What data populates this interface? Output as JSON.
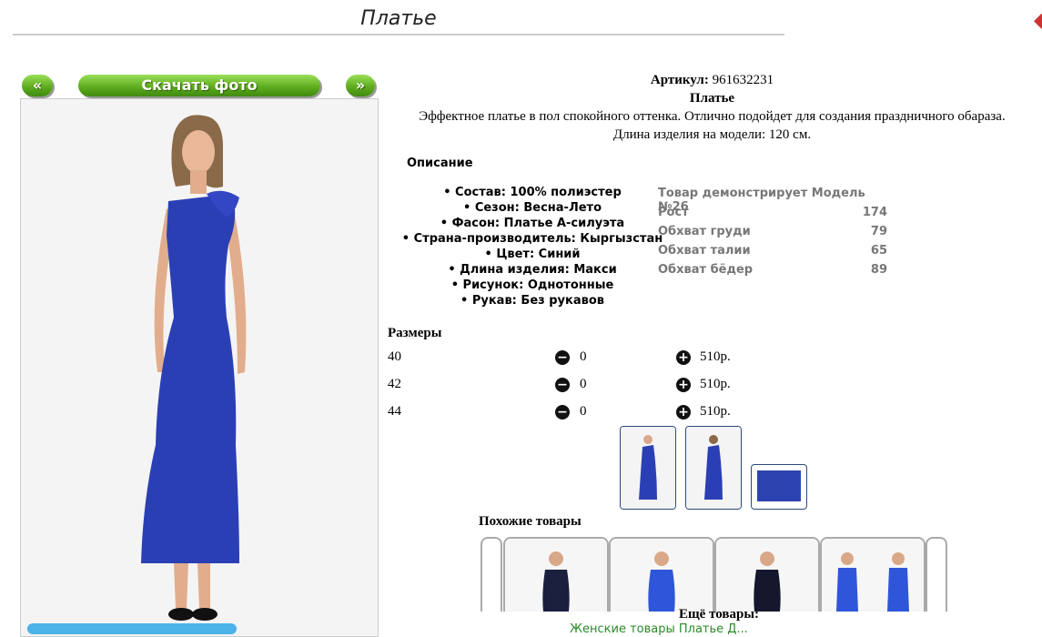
{
  "page": {
    "title": "Платье"
  },
  "controls": {
    "prev": "«",
    "download": "Скачать фото",
    "next": "»"
  },
  "product": {
    "article_label": "Артикул:",
    "article": "961632231",
    "name": "Платье",
    "description": "Эффектное платье в пол спокойного оттенка. Отлично подойдет для создания праздничного обараза.",
    "length_note": "Длина изделия на модели: 120 см."
  },
  "description_heading": "Описание",
  "properties": [
    "Состав: 100% полиэстер",
    "Сезон: Весна-Лето",
    "Фасон: Платье А-силуэта",
    "Страна-производитель: Кыргызстан",
    "Цвет: Синий",
    "Длина изделия: Макси",
    "Рисунок: Однотонные",
    "Рукав: Без рукавов"
  ],
  "model": {
    "heading": "Товар демонстрирует Модель №26",
    "rows": [
      {
        "label": "Рост",
        "value": "174"
      },
      {
        "label": "Обхват груди",
        "value": "79"
      },
      {
        "label": "Обхват талии",
        "value": "65"
      },
      {
        "label": "Обхват бёдер",
        "value": "89"
      }
    ]
  },
  "sizes": {
    "heading": "Размеры",
    "rows": [
      {
        "size": "40",
        "qty": "0",
        "price": "510р."
      },
      {
        "size": "42",
        "qty": "0",
        "price": "510р."
      },
      {
        "size": "44",
        "qty": "0",
        "price": "510р."
      }
    ]
  },
  "similar": {
    "heading": "Похожие товары"
  },
  "more": {
    "heading": "Ещё товары:",
    "links": "Женские товары   Платье   Д..."
  },
  "colors": {
    "dress": "#2b3fb5",
    "accent_green": "#5fad1e",
    "swatch": "#2d44b0"
  }
}
